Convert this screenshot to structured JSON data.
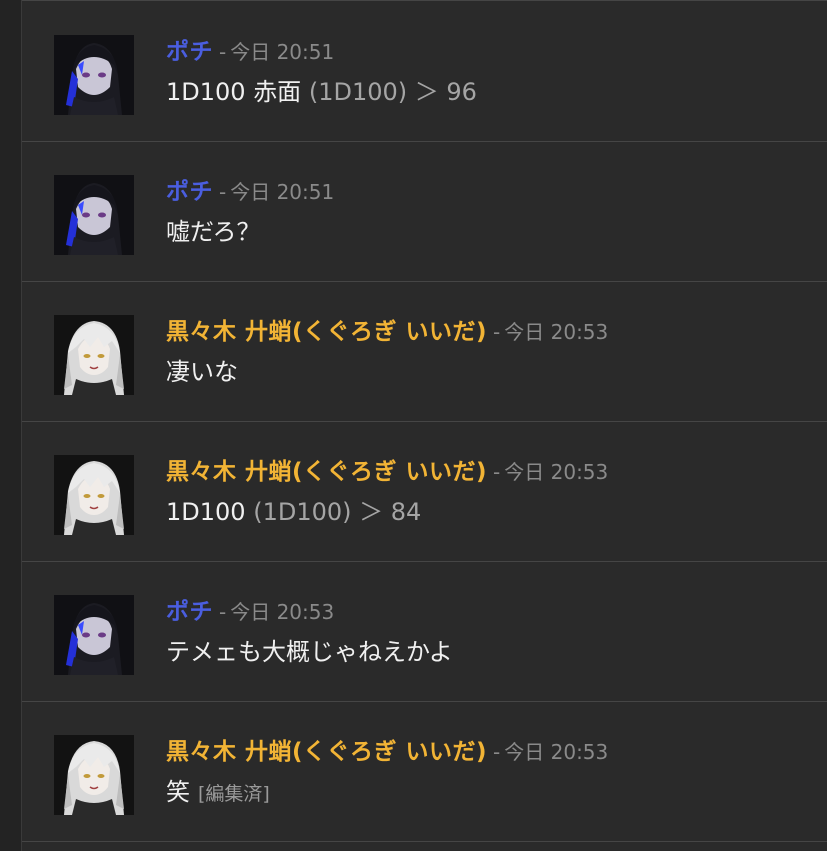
{
  "users": {
    "pochi": {
      "name": "ポチ",
      "color": "#4a5ee0",
      "avatar": "pochi-avatar"
    },
    "kurogi": {
      "name": "黒々木 廾蛸(くぐろぎ いいだ)",
      "color": "#f2b435",
      "avatar": "kurogi-avatar"
    }
  },
  "separator": "-",
  "messages": [
    {
      "author": "ポチ",
      "timestamp": "今日 20:51",
      "content_main": "1D100 赤面",
      "content_dim": "(1D100)",
      "content_result": "＞ 96",
      "edited": ""
    },
    {
      "author": "ポチ",
      "timestamp": "今日 20:51",
      "content_main": "嘘だろ？",
      "content_dim": "",
      "content_result": "",
      "edited": ""
    },
    {
      "author": "黒々木 廾蛸(くぐろぎ いいだ)",
      "timestamp": "今日 20:53",
      "content_main": "凄いな",
      "content_dim": "",
      "content_result": "",
      "edited": ""
    },
    {
      "author": "黒々木 廾蛸(くぐろぎ いいだ)",
      "timestamp": "今日 20:53",
      "content_main": "1D100",
      "content_dim": "(1D100)",
      "content_result": "＞ 84",
      "edited": ""
    },
    {
      "author": "ポチ",
      "timestamp": "今日 20:53",
      "content_main": "テメェも大概じゃねえかよ",
      "content_dim": "",
      "content_result": "",
      "edited": ""
    },
    {
      "author": "黒々木 廾蛸(くぐろぎ いいだ)",
      "timestamp": "今日 20:53",
      "content_main": "笑",
      "content_dim": "",
      "content_result": "",
      "edited": "[編集済]"
    }
  ]
}
